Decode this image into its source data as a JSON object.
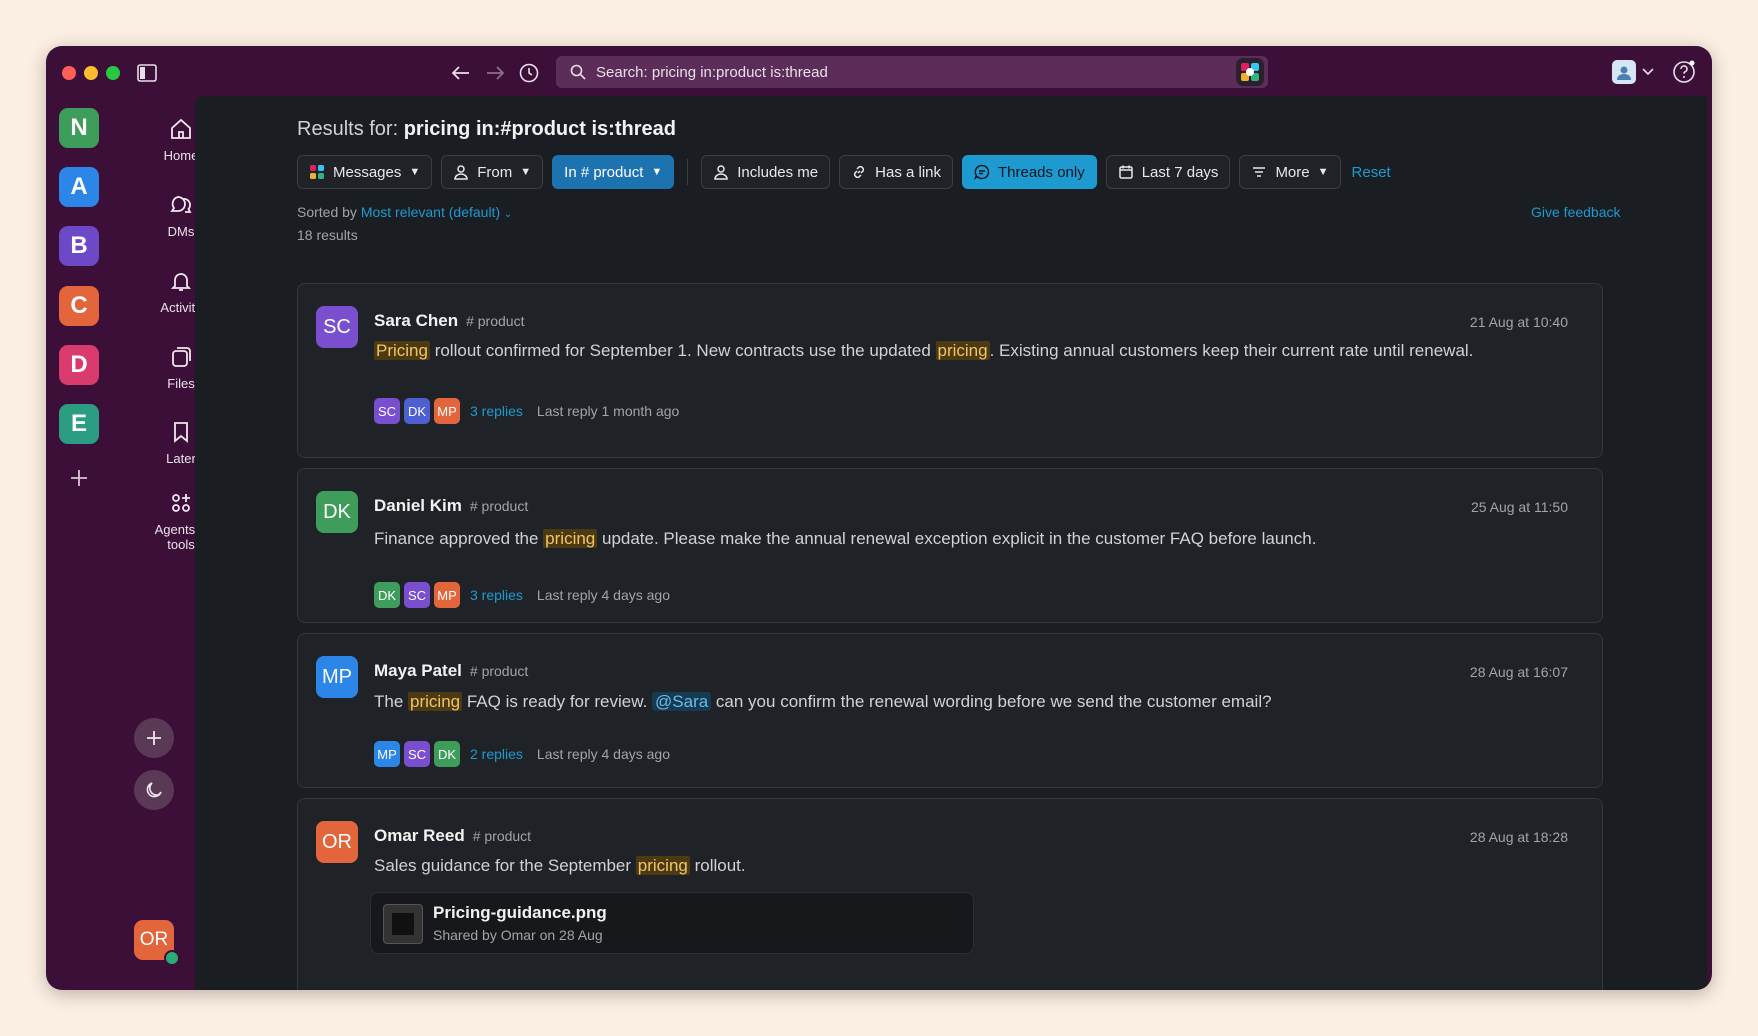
{
  "search": {
    "query": "Search: pricing in:product is:thread"
  },
  "workspaces": [
    {
      "letter": "N",
      "color": "#3f9d5c"
    },
    {
      "letter": "A",
      "color": "#2b86e8"
    },
    {
      "letter": "B",
      "color": "#6d49c7"
    },
    {
      "letter": "C",
      "color": "#e2653b"
    },
    {
      "letter": "D",
      "color": "#d93b6c"
    },
    {
      "letter": "E",
      "color": "#2a9d82"
    }
  ],
  "nav": {
    "home": "Home",
    "dms": "DMs",
    "activity": "Activity",
    "files": "Files",
    "later": "Later",
    "agents_line1": "Agents &",
    "agents_line2": "tools"
  },
  "me": {
    "initials": "OR"
  },
  "results": {
    "prefix": "Results for:",
    "query": "pricing in:#product is:thread",
    "sorted_label": "Sorted by",
    "sort_value": "Most relevant (default)",
    "count": "18 results",
    "feedback": "Give feedback"
  },
  "filters": {
    "messages": "Messages",
    "from": "From",
    "in_channel": "In # product",
    "includes_me": "Includes me",
    "has_link": "Has a link",
    "threads_only": "Threads only",
    "last7": "Last 7 days",
    "more": "More",
    "reset": "Reset"
  },
  "messages": [
    {
      "initials": "SC",
      "avatar_color": "#7a4fcf",
      "name": "Sara Chen",
      "channel": "# product",
      "time": "21 Aug at 10:40",
      "text_parts": [
        "",
        "Pricing",
        " rollout confirmed for September 1. New contracts use the updated ",
        "pricing",
        ". Existing annual customers keep their current rate until renewal."
      ],
      "participants": [
        {
          "i": "SC",
          "c": "#7a4fcf"
        },
        {
          "i": "DK",
          "c": "#4e5fd1"
        },
        {
          "i": "MP",
          "c": "#e2653b"
        }
      ],
      "replies": "3 replies",
      "last_reply": "Last reply 1 month ago"
    },
    {
      "initials": "DK",
      "avatar_color": "#3f9d5c",
      "name": "Daniel Kim",
      "channel": "# product",
      "time": "25 Aug at 11:50",
      "text_parts": [
        "Finance approved the ",
        "pricing",
        " update. Please make the annual renewal exception explicit in the customer FAQ before launch."
      ],
      "participants": [
        {
          "i": "DK",
          "c": "#3f9d5c"
        },
        {
          "i": "SC",
          "c": "#7a4fcf"
        },
        {
          "i": "MP",
          "c": "#e2653b"
        }
      ],
      "replies": "3 replies",
      "last_reply": "Last reply 4 days ago"
    },
    {
      "initials": "MP",
      "avatar_color": "#2b86e8",
      "name": "Maya Patel",
      "channel": "# product",
      "time": "28 Aug at 16:07",
      "text_parts": [
        "The ",
        "pricing",
        " FAQ is ready for review. ",
        "@Sara",
        " can you confirm the renewal wording before we send the customer email?"
      ],
      "participants": [
        {
          "i": "MP",
          "c": "#2b86e8"
        },
        {
          "i": "SC",
          "c": "#7a4fcf"
        },
        {
          "i": "DK",
          "c": "#3f9d5c"
        }
      ],
      "replies": "2 replies",
      "last_reply": "Last reply 4 days ago"
    },
    {
      "initials": "OR",
      "avatar_color": "#e2653b",
      "name": "Omar Reed",
      "channel": "# product",
      "time": "28 Aug at 18:28",
      "text_parts": [
        "Sales guidance for the September ",
        "pricing",
        " rollout."
      ],
      "file": {
        "name": "Pricing-guidance.png",
        "meta": "Shared by Omar on 28 Aug"
      }
    }
  ]
}
